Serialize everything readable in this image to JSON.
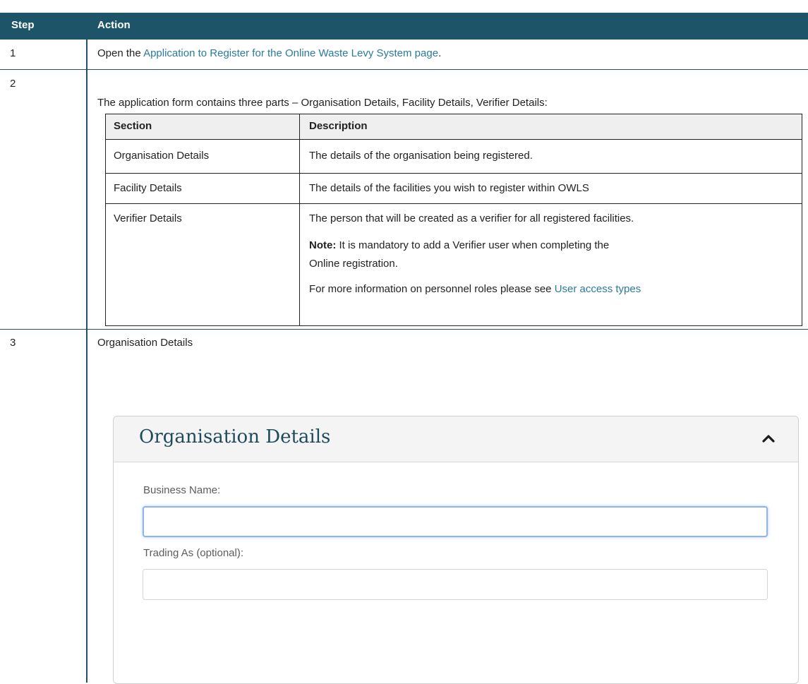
{
  "table": {
    "headers": {
      "step": "Step",
      "action": "Action"
    },
    "rows": [
      {
        "step": "1",
        "pre": "Open the ",
        "link": "Application to Register for the Online Waste Levy System page",
        "post": "."
      },
      {
        "step": "2",
        "text": "The application form contains three parts – Organisation Details, Facility Details, Verifier Details:"
      },
      {
        "step": "3",
        "text": "Organisation Details"
      }
    ]
  },
  "sections_table": {
    "headers": {
      "section": "Section",
      "description": "Description"
    },
    "rows": [
      {
        "section": "Organisation Details",
        "description": "The details of the organisation being registered."
      },
      {
        "section": "Facility Details",
        "description": "The details of the facilities you wish to register within OWLS"
      },
      {
        "section": "Verifier Details",
        "description": "The person that will be created as a verifier for all registered facilities.",
        "note_label": "Note:",
        "note_line1": " It is mandatory to add a Verifier user when completing the",
        "note_line2": "Online registration.",
        "more_pre": "For more information on personnel roles please see ",
        "more_link": "User access types"
      }
    ]
  },
  "form": {
    "title": "Organisation Details",
    "fields": [
      {
        "label": "Business Name:",
        "value": ""
      },
      {
        "label": "Trading As (optional):",
        "value": ""
      }
    ]
  },
  "colors": {
    "header_bg": "#1e5468",
    "link": "#2b7a9c",
    "title": "#1e4a5c"
  }
}
